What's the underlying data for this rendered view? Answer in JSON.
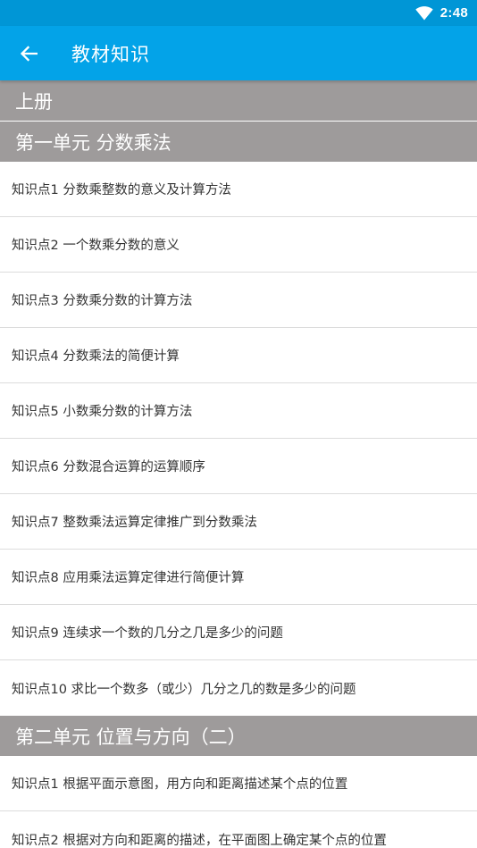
{
  "status_bar": {
    "time": "2:48",
    "wifi_icon": "wifi-icon"
  },
  "app_bar": {
    "back_icon": "arrow-left-icon",
    "title": "教材知识"
  },
  "colors": {
    "status_bar": "#0096d6",
    "app_bar": "#03a3e8",
    "section_header": "#9e9b9b"
  },
  "volume": {
    "label": "上册"
  },
  "units": [
    {
      "title": "第一单元 分数乘法",
      "items": [
        "知识点1 分数乘整数的意义及计算方法",
        "知识点2 一个数乘分数的意义",
        "知识点3 分数乘分数的计算方法",
        "知识点4 分数乘法的简便计算",
        "知识点5 小数乘分数的计算方法",
        "知识点6 分数混合运算的运算顺序",
        "知识点7 整数乘法运算定律推广到分数乘法",
        "知识点8 应用乘法运算定律进行简便计算",
        "知识点9 连续求一个数的几分之几是多少的问题",
        "知识点10 求比一个数多（或少）几分之几的数是多少的问题"
      ]
    },
    {
      "title": "第二单元 位置与方向（二）",
      "items": [
        "知识点1 根据平面示意图，用方向和距离描述某个点的位置",
        "知识点2 根据对方向和距离的描述，在平面图上确定某个点的位置"
      ]
    }
  ]
}
